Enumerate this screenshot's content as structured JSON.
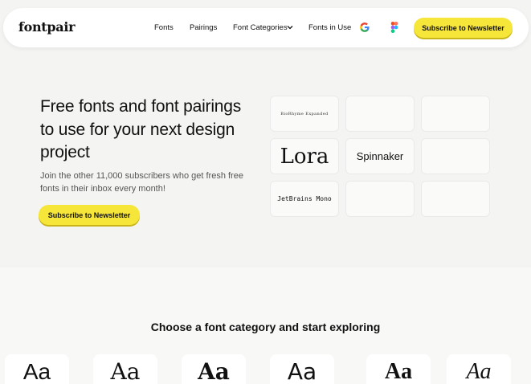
{
  "header": {
    "logo": "fontpair",
    "nav": [
      {
        "label": "Fonts"
      },
      {
        "label": "Pairings"
      },
      {
        "label": "Font Categories"
      },
      {
        "label": "Fonts in Use"
      }
    ],
    "icons": [
      "google-icon",
      "figma-icon",
      "chevron-down-icon"
    ],
    "cta_label": "Subscribe to Newsletter"
  },
  "hero": {
    "title": "Free fonts and font pairings to use for your next design project",
    "subtitle": "Join the other 11,000 subscribers who get fresh free fonts in their inbox every month!",
    "cta_label": "Subscribe to Newsletter",
    "tiles": [
      {
        "text": "BioRhyme Expanded"
      },
      {
        "text": ""
      },
      {
        "text": ""
      },
      {
        "text": "Lora"
      },
      {
        "text": "Spinnaker"
      },
      {
        "text": ""
      },
      {
        "text": "JetBrains Mono"
      },
      {
        "text": ""
      },
      {
        "text": ""
      }
    ]
  },
  "categories": {
    "heading": "Choose a font category and start exploring",
    "samples": [
      "Aa",
      "Aa",
      "Aa",
      "Aa",
      "Aa",
      "Aa"
    ]
  },
  "colors": {
    "accent": "#f6e63a",
    "background": "#f4f4f2",
    "text": "#111111"
  }
}
